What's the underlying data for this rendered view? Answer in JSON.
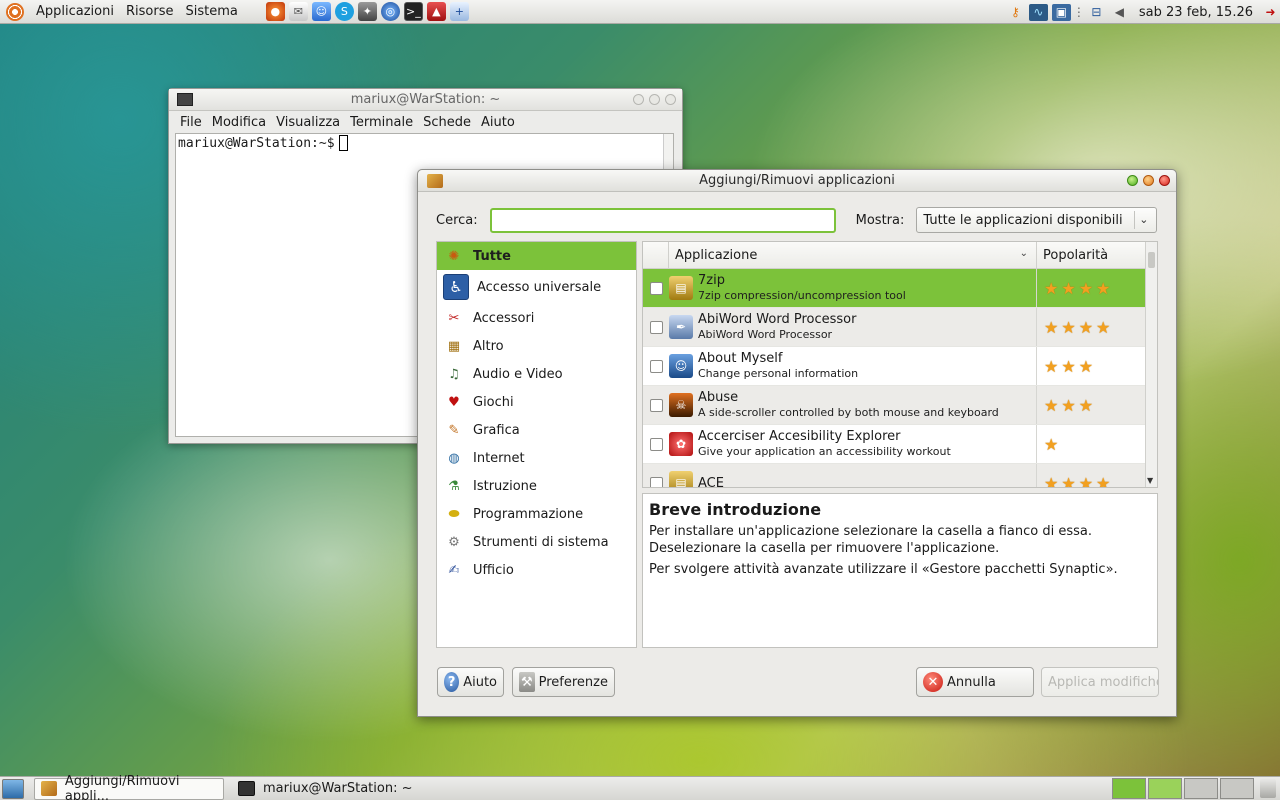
{
  "top_panel": {
    "menus": [
      "Applicazioni",
      "Risorse",
      "Sistema"
    ],
    "clock": "sab 23 feb, 15.26"
  },
  "terminal": {
    "title": "mariux@WarStation: ~",
    "menu": [
      "File",
      "Modifica",
      "Visualizza",
      "Terminale",
      "Schede",
      "Aiuto"
    ],
    "prompt": "mariux@WarStation:~$"
  },
  "addremove": {
    "title": "Aggiungi/Rimuovi applicazioni",
    "search_label": "Cerca:",
    "search_value": "",
    "show_label": "Mostra:",
    "show_value": "Tutte le applicazioni disponibili",
    "categories": [
      "Tutte",
      "Accesso universale",
      "Accessori",
      "Altro",
      "Audio e Video",
      "Giochi",
      "Grafica",
      "Internet",
      "Istruzione",
      "Programmazione",
      "Strumenti di sistema",
      "Ufficio"
    ],
    "columns": {
      "app": "Applicazione",
      "pop": "Popolarità"
    },
    "apps": [
      {
        "name": "7zip",
        "desc": "7zip compression/uncompression tool",
        "stars": 4
      },
      {
        "name": "AbiWord Word Processor",
        "desc": "AbiWord Word Processor",
        "stars": 4
      },
      {
        "name": "About Myself",
        "desc": "Change personal information",
        "stars": 3
      },
      {
        "name": "Abuse",
        "desc": "A side-scroller controlled by both mouse and keyboard",
        "stars": 3
      },
      {
        "name": "Accerciser Accesibility Explorer",
        "desc": "Give your application an accessibility workout",
        "stars": 1
      },
      {
        "name": "ACE",
        "desc": "",
        "stars": 4
      }
    ],
    "intro": {
      "title": "Breve introduzione",
      "line1": "Per installare un'applicazione selezionare la casella a fianco di essa.",
      "line2": "Deselezionare la casella per rimuovere l'applicazione.",
      "line3": "Per svolgere attività avanzate utilizzare il «Gestore pacchetti Synaptic»."
    },
    "buttons": {
      "help": "Aiuto",
      "prefs": "Preferenze",
      "cancel": "Annulla",
      "apply": "Applica modifiche"
    }
  },
  "bottom_panel": {
    "tasks": [
      "Aggiungi/Rimuovi appli...",
      "mariux@WarStation: ~"
    ]
  },
  "colors": {
    "accent": "#7cc23a",
    "star": "#f2a020"
  }
}
